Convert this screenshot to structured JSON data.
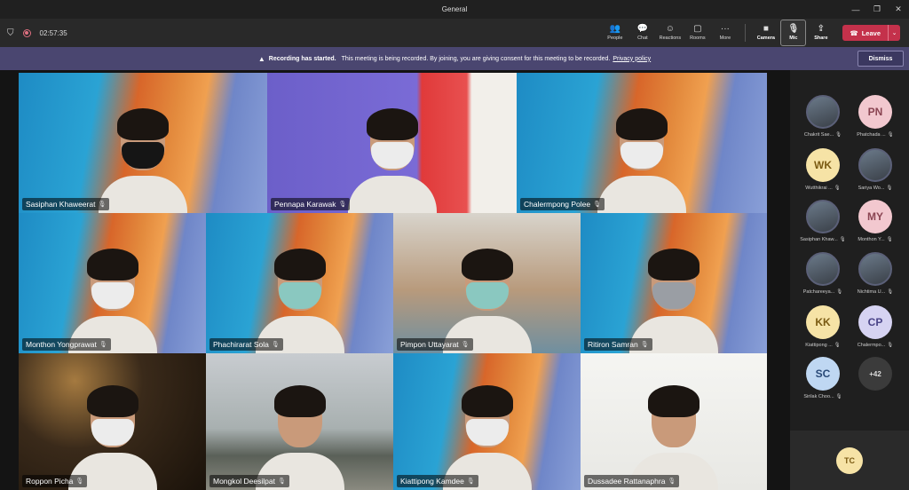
{
  "window": {
    "title": "General",
    "controls": [
      "—",
      "❐",
      "✕"
    ]
  },
  "toolbar": {
    "timer": "02:57:35",
    "buttons": [
      {
        "label": "People",
        "icon": "people-icon"
      },
      {
        "label": "Chat",
        "icon": "chat-icon"
      },
      {
        "label": "Reactions",
        "icon": "reactions-icon"
      },
      {
        "label": "Rooms",
        "icon": "rooms-icon"
      },
      {
        "label": "More",
        "icon": "more-icon"
      }
    ],
    "camera_label": "Camera",
    "mic_label": "Mic",
    "share_label": "Share",
    "leave_label": "Leave"
  },
  "banner": {
    "title": "Recording has started.",
    "message": "This meeting is being recorded. By joining, you are giving consent for this meeting to be recorded.",
    "link": "Privacy policy",
    "dismiss": "Dismiss"
  },
  "tiles": [
    {
      "name": "Sasiphan  Khaweerat",
      "bg": "orange",
      "mask": "black"
    },
    {
      "name": "Pennapa Karawak",
      "bg": "purple",
      "mask": "white"
    },
    {
      "name": "Chalermpong  Polee",
      "bg": "orange",
      "mask": "white"
    },
    {
      "name": "Monthon Yongprawat",
      "bg": "orange",
      "mask": "white"
    },
    {
      "name": "Phachirarat  Sola",
      "bg": "orange",
      "mask": "blue"
    },
    {
      "name": "Pimpon  Uttayarat",
      "bg": "office",
      "mask": "blue"
    },
    {
      "name": "Ritiron  Samran",
      "bg": "orange",
      "mask": "gray"
    },
    {
      "name": "Roppon  Picha",
      "bg": "bar",
      "mask": "white"
    },
    {
      "name": "Mongkol  Deesilpat",
      "bg": "sea",
      "mask": "none"
    },
    {
      "name": "Kiattipong  Kamdee",
      "bg": "orange",
      "mask": "white"
    },
    {
      "name": "Dussadee  Rattanaphra",
      "bg": "white",
      "mask": "none"
    }
  ],
  "roster": [
    {
      "initials": "",
      "name": "Chakrit Sae...",
      "style": "photo"
    },
    {
      "initials": "PN",
      "name": "Phatchada ...",
      "style": "pink"
    },
    {
      "initials": "WK",
      "name": "Wutthikrai ...",
      "style": "yellow"
    },
    {
      "initials": "",
      "name": "Sariya Wo...",
      "style": "photo"
    },
    {
      "initials": "",
      "name": "Sasiphan Khaw...",
      "style": "photo"
    },
    {
      "initials": "MY",
      "name": "Monthon Y...",
      "style": "pink"
    },
    {
      "initials": "",
      "name": "Patchareeya...",
      "style": "photo"
    },
    {
      "initials": "",
      "name": "Nichtima U...",
      "style": "photo"
    },
    {
      "initials": "KK",
      "name": "Kiattipong ...",
      "style": "yellow"
    },
    {
      "initials": "CP",
      "name": "Chalermpo...",
      "style": "lav"
    },
    {
      "initials": "SC",
      "name": "Sirilak Choo...",
      "style": "blue"
    },
    {
      "initials": "+42",
      "name": "",
      "style": "dark"
    }
  ],
  "self": {
    "initials": "TC"
  },
  "colors": {
    "leave": "#c4314b",
    "banner": "#4a4670",
    "accent": "#6264a7"
  }
}
